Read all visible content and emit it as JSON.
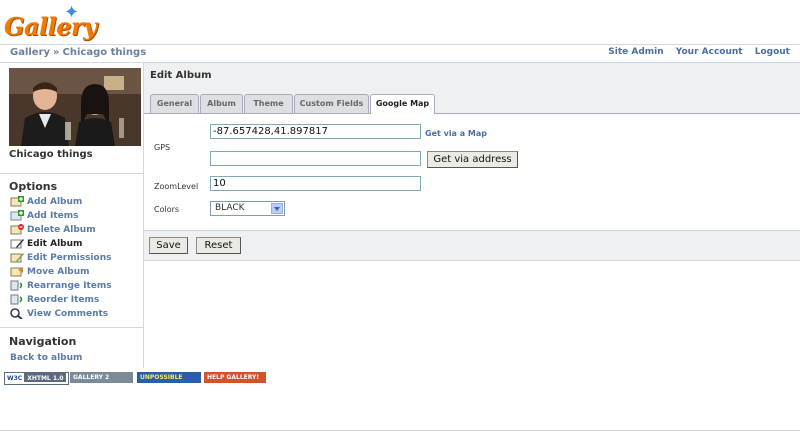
{
  "header": {
    "logo_text": "Gallery"
  },
  "breadcrumb": {
    "root": "Gallery",
    "separator": "»",
    "current": "Chicago things"
  },
  "system_links": [
    "Site Admin",
    "Your Account",
    "Logout"
  ],
  "sidebar": {
    "album_title": "Chicago things",
    "options_heading": "Options",
    "options": [
      {
        "label": "Add Album",
        "icon": "add-album-icon"
      },
      {
        "label": "Add Items",
        "icon": "add-items-icon"
      },
      {
        "label": "Delete Album",
        "icon": "delete-album-icon"
      },
      {
        "label": "Edit Album",
        "icon": "edit-album-icon",
        "current": true
      },
      {
        "label": "Edit Permissions",
        "icon": "edit-permissions-icon"
      },
      {
        "label": "Move Album",
        "icon": "move-album-icon"
      },
      {
        "label": "Rearrange Items",
        "icon": "rearrange-items-icon"
      },
      {
        "label": "Reorder Items",
        "icon": "reorder-items-icon"
      },
      {
        "label": "View Comments",
        "icon": "view-comments-icon"
      }
    ],
    "navigation_heading": "Navigation",
    "back_link": "Back to album"
  },
  "badges": [
    {
      "label": "W3C XHTML 1.0",
      "bg": "#5b6a7d"
    },
    {
      "label": "GALLERY 2",
      "bg": "#7a8a96"
    },
    {
      "label": "UNPOSSIBLE",
      "bg": "#2a5ea8"
    },
    {
      "label": "HELP GALLERY!",
      "bg": "#d0532b"
    }
  ],
  "main": {
    "title": "Edit Album",
    "tabs": [
      {
        "label": "General"
      },
      {
        "label": "Album"
      },
      {
        "label": "Theme"
      },
      {
        "label": "Custom Fields"
      },
      {
        "label": "Google Map",
        "active": true
      }
    ],
    "form": {
      "gps_label": "GPS",
      "gps_value": "-87.657428,41.897817",
      "get_via_map": "Get via a Map",
      "address_value": "",
      "get_via_address": "Get via address",
      "zoom_label": "ZoomLevel",
      "zoom_value": "10",
      "colors_label": "Colors",
      "colors_value": "BLACK"
    },
    "actions": {
      "save": "Save",
      "reset": "Reset"
    }
  }
}
